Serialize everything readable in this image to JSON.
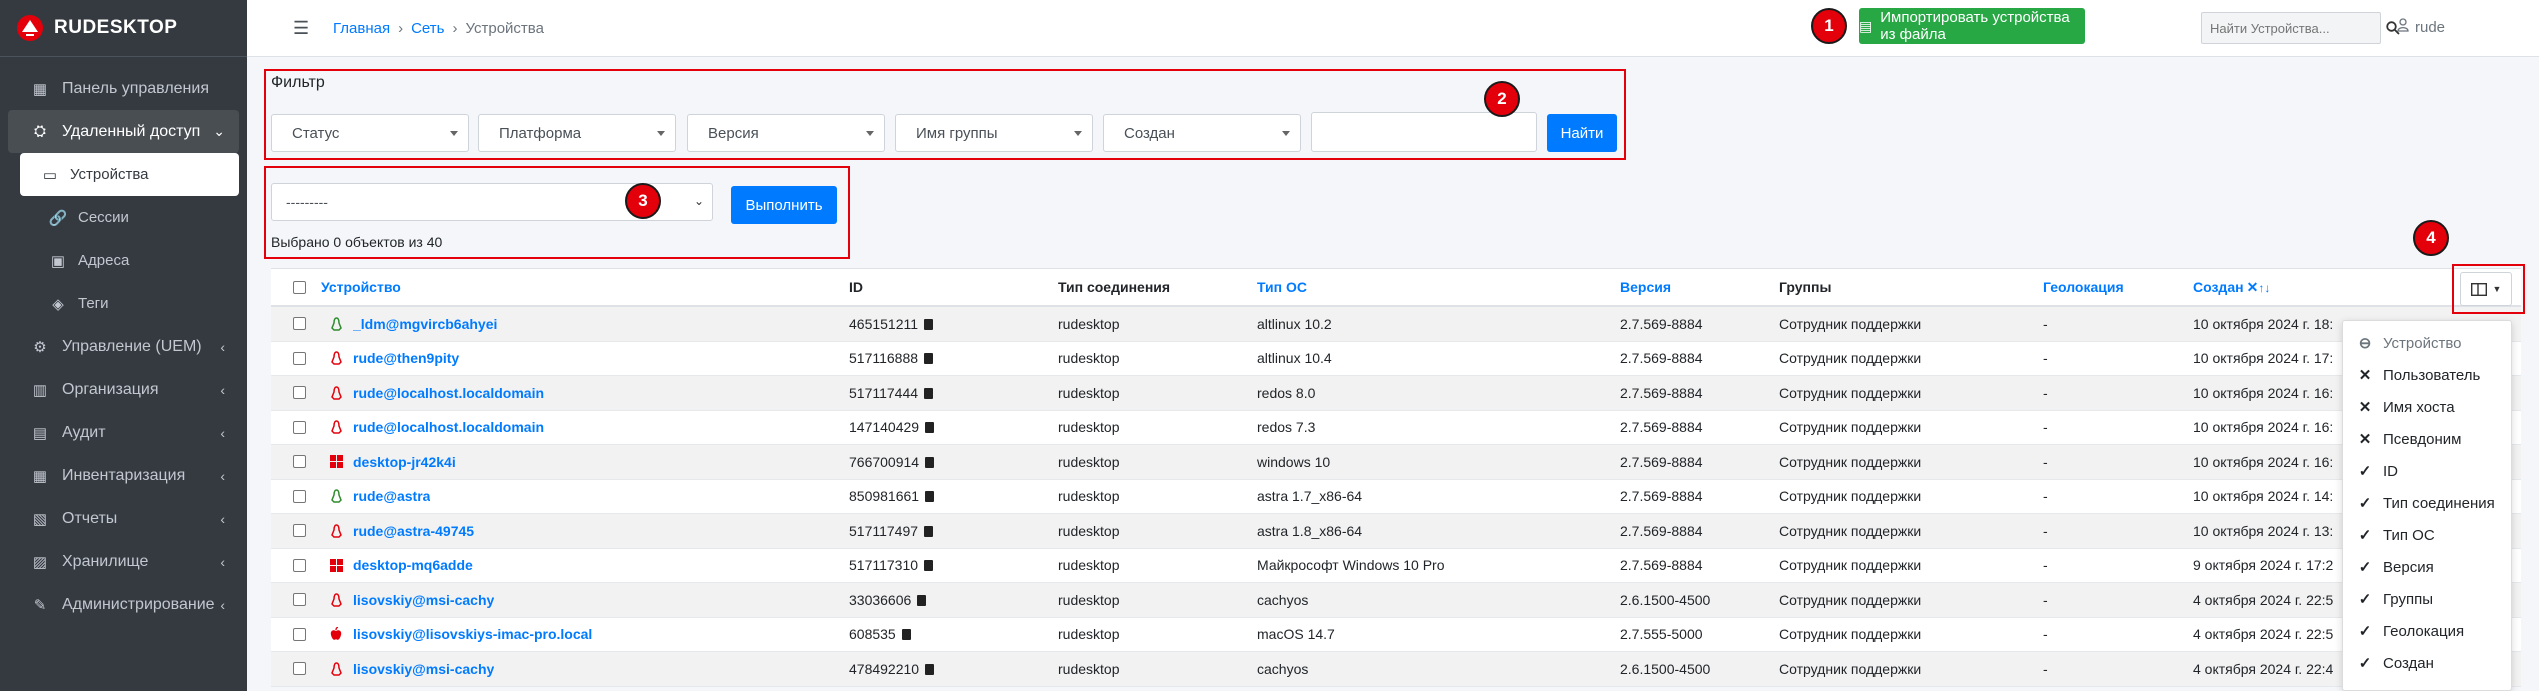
{
  "brand": {
    "name": "RUDESKTOP"
  },
  "sidebar": {
    "items": [
      {
        "label": "Панель управления",
        "icon": "dashboard-icon"
      },
      {
        "label": "Удаленный доступ",
        "icon": "remote-access-icon",
        "open": true
      },
      {
        "label": "Устройства",
        "icon": "devices-icon",
        "sub": true,
        "active": true
      },
      {
        "label": "Сессии",
        "icon": "link-icon",
        "sub": true
      },
      {
        "label": "Адреса",
        "icon": "address-book-icon",
        "sub": true
      },
      {
        "label": "Теги",
        "icon": "tags-icon",
        "sub": true
      },
      {
        "label": "Управление (UEM)",
        "icon": "gears-icon"
      },
      {
        "label": "Организация",
        "icon": "organization-icon"
      },
      {
        "label": "Аудит",
        "icon": "audit-icon"
      },
      {
        "label": "Инвентаризация",
        "icon": "inventory-icon"
      },
      {
        "label": "Отчеты",
        "icon": "reports-icon"
      },
      {
        "label": "Хранилище",
        "icon": "storage-icon"
      },
      {
        "label": "Администрирование",
        "icon": "admin-icon"
      }
    ]
  },
  "header": {
    "breadcrumb": [
      "Главная",
      "Сеть",
      "Устройства"
    ],
    "import_label": "Импортировать устройства из файла",
    "search_placeholder": "Найти Устройства...",
    "user": "rude"
  },
  "markers": [
    "1",
    "2",
    "3",
    "4"
  ],
  "filter": {
    "title": "Фильтр",
    "selects": [
      "Статус",
      "Платформа",
      "Версия",
      "Имя группы",
      "Создан"
    ],
    "find_label": "Найти"
  },
  "actions": {
    "select_value": "---------",
    "run_label": "Выполнить",
    "selected_info": "Выбрано 0 объектов из 40"
  },
  "table": {
    "headers": {
      "device": "Устройство",
      "id": "ID",
      "conn": "Тип соединения",
      "os": "Тип ОС",
      "version": "Версия",
      "groups": "Группы",
      "geo": "Геолокация",
      "created": "Создан"
    },
    "rows": [
      {
        "device": "_ldm@mgvircb6ahyei",
        "os_icon": "linux-green",
        "id": "465151211",
        "conn": "rudesktop",
        "os": "altlinux 10.2",
        "version": "2.7.569-8884",
        "groups": "Сотрудник поддержки",
        "geo": "-",
        "created": "10 октября 2024 г. 18:"
      },
      {
        "device": "rude@then9pity",
        "os_icon": "linux-red",
        "id": "517116888",
        "conn": "rudesktop",
        "os": "altlinux 10.4",
        "version": "2.7.569-8884",
        "groups": "Сотрудник поддержки",
        "geo": "-",
        "created": "10 октября 2024 г. 17:"
      },
      {
        "device": "rude@localhost.localdomain",
        "os_icon": "linux-red",
        "id": "517117444",
        "conn": "rudesktop",
        "os": "redos 8.0",
        "version": "2.7.569-8884",
        "groups": "Сотрудник поддержки",
        "geo": "-",
        "created": "10 октября 2024 г. 16:"
      },
      {
        "device": "rude@localhost.localdomain",
        "os_icon": "linux-red",
        "id": "147140429",
        "conn": "rudesktop",
        "os": "redos 7.3",
        "version": "2.7.569-8884",
        "groups": "Сотрудник поддержки",
        "geo": "-",
        "created": "10 октября 2024 г. 16:"
      },
      {
        "device": "desktop-jr42k4i",
        "os_icon": "windows",
        "id": "766700914",
        "conn": "rudesktop",
        "os": "windows 10",
        "version": "2.7.569-8884",
        "groups": "Сотрудник поддержки",
        "geo": "-",
        "created": "10 октября 2024 г. 16:"
      },
      {
        "device": "rude@astra",
        "os_icon": "linux-green",
        "id": "850981661",
        "conn": "rudesktop",
        "os": "astra 1.7_x86-64",
        "version": "2.7.569-8884",
        "groups": "Сотрудник поддержки",
        "geo": "-",
        "created": "10 октября 2024 г. 14:"
      },
      {
        "device": "rude@astra-49745",
        "os_icon": "linux-red",
        "id": "517117497",
        "conn": "rudesktop",
        "os": "astra 1.8_x86-64",
        "version": "2.7.569-8884",
        "groups": "Сотрудник поддержки",
        "geo": "-",
        "created": "10 октября 2024 г. 13:"
      },
      {
        "device": "desktop-mq6adde",
        "os_icon": "windows",
        "id": "517117310",
        "conn": "rudesktop",
        "os": "Майкрософт Windows 10 Pro",
        "version": "2.7.569-8884",
        "groups": "Сотрудник поддержки",
        "geo": "-",
        "created": "9 октября 2024 г. 17:2"
      },
      {
        "device": "lisovskiy@msi-cachy",
        "os_icon": "linux-red",
        "id": "33036606",
        "conn": "rudesktop",
        "os": "cachyos",
        "version": "2.6.1500-4500",
        "groups": "Сотрудник поддержки",
        "geo": "-",
        "created": "4 октября 2024 г. 22:5"
      },
      {
        "device": "lisovskiy@lisovskiys-imac-pro.local",
        "os_icon": "apple",
        "id": "608535",
        "conn": "rudesktop",
        "os": "macOS 14.7",
        "version": "2.7.555-5000",
        "groups": "Сотрудник поддержки",
        "geo": "-",
        "created": "4 октября 2024 г. 22:5"
      },
      {
        "device": "lisovskiy@msi-cachy",
        "os_icon": "linux-red",
        "id": "478492210",
        "conn": "rudesktop",
        "os": "cachyos",
        "version": "2.6.1500-4500",
        "groups": "Сотрудник поддержки",
        "geo": "-",
        "created": "4 октября 2024 г. 22:4"
      }
    ]
  },
  "column_menu": {
    "items": [
      {
        "label": "Устройство",
        "state": "disabled"
      },
      {
        "label": "Пользователь",
        "state": "hidden"
      },
      {
        "label": "Имя хоста",
        "state": "hidden"
      },
      {
        "label": "Псевдоним",
        "state": "hidden"
      },
      {
        "label": "ID",
        "state": "shown"
      },
      {
        "label": "Тип соединения",
        "state": "shown"
      },
      {
        "label": "Тип ОС",
        "state": "shown"
      },
      {
        "label": "Версия",
        "state": "shown"
      },
      {
        "label": "Группы",
        "state": "shown"
      },
      {
        "label": "Геолокация",
        "state": "shown"
      },
      {
        "label": "Создан",
        "state": "shown"
      }
    ]
  },
  "colors": {
    "sidebar": "#343a40",
    "primary": "#007bff",
    "success": "#28a745",
    "marker": "#e3000b"
  }
}
